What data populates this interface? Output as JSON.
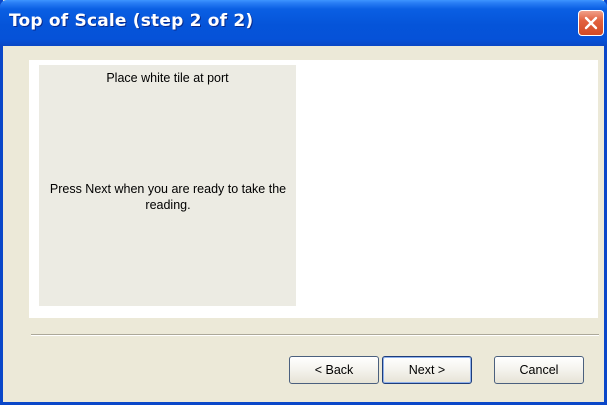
{
  "window": {
    "title": "Top of Scale (step 2 of 2)"
  },
  "instructions": {
    "line1": "Place white tile at port",
    "line2": "Press Next when you are ready to take the reading."
  },
  "buttons": {
    "back": "< Back",
    "next": "Next >",
    "cancel": "Cancel"
  },
  "icons": {
    "close": "close-icon"
  },
  "colors": {
    "titlebar": "#0554d9",
    "close_button": "#d24a25",
    "dialog_background": "#ece9d8",
    "panel_background": "#ecebe3"
  }
}
